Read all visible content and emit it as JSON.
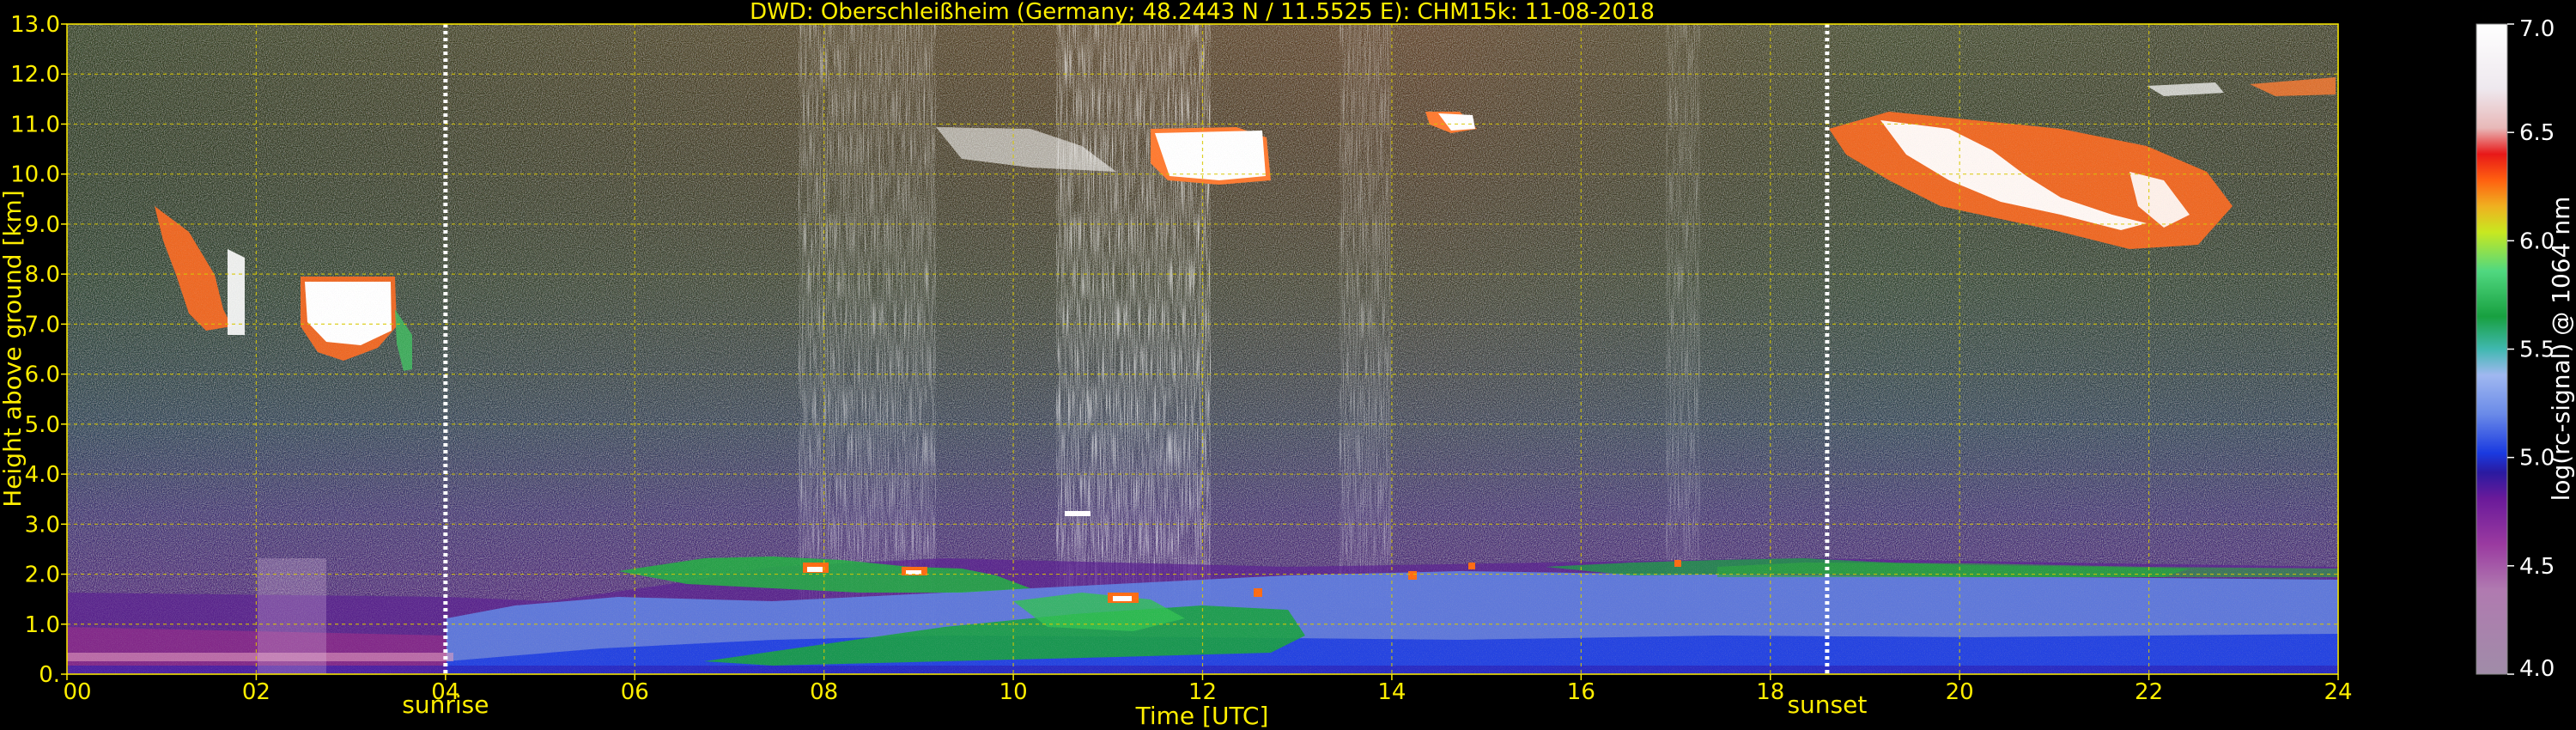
{
  "chart_data": {
    "type": "heatmap",
    "title": "DWD: Oberschleißheim (Germany; 48.2443 N / 11.5525 E):    CHM15k: 11-08-2018",
    "xlabel": "Time [UTC]",
    "ylabel": "Height above ground [km]",
    "x_ticks": [
      "00",
      "02",
      "04",
      "06",
      "08",
      "10",
      "12",
      "14",
      "16",
      "18",
      "20",
      "22",
      "24"
    ],
    "y_ticks": [
      "0.",
      "1.0",
      "2.0",
      "3.0",
      "4.0",
      "5.0",
      "6.0",
      "7.0",
      "8.0",
      "9.0",
      "10.0",
      "11.0",
      "12.0",
      "13.0"
    ],
    "xlim": [
      0,
      24
    ],
    "ylim": [
      0,
      13
    ],
    "grid": true,
    "events": [
      {
        "name": "sunrise",
        "time": 4.0
      },
      {
        "name": "sunset",
        "time": 18.6
      }
    ],
    "colorbar": {
      "label": "log(rc-signal) @ 1064 nm",
      "range": [
        4.0,
        7.0
      ],
      "tick_labels": [
        "4.0",
        "4.5",
        "5.0",
        "5.5",
        "6.0",
        "6.5",
        "7.0"
      ]
    },
    "colors": {
      "axis": "#ffee00",
      "grid": "#d8c800",
      "background": "#000000"
    }
  }
}
